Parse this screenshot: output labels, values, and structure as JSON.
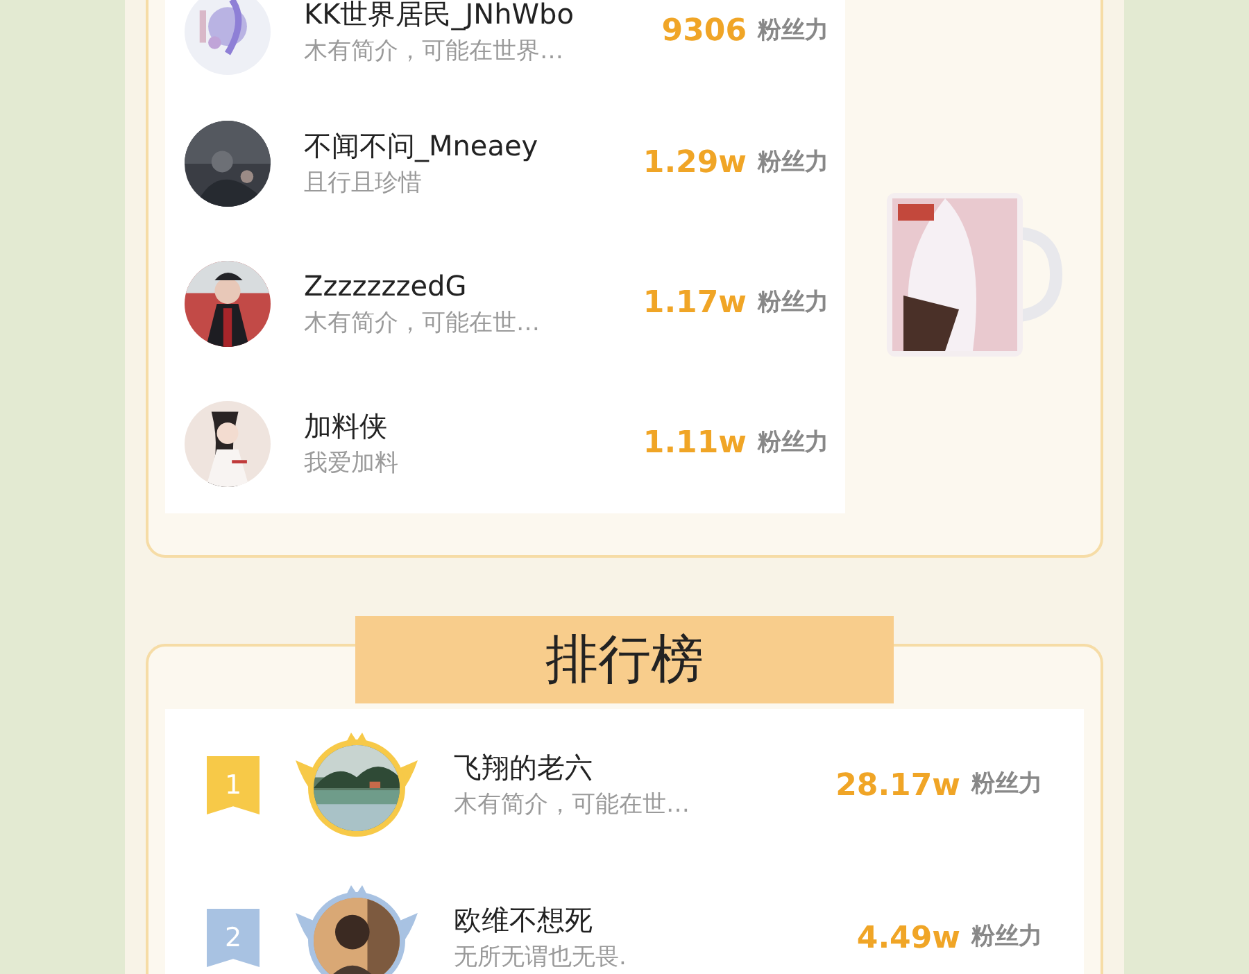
{
  "fans": [
    {
      "name": "KK世界居民_JNhWbo",
      "bio": "木有简介，可能在世界…",
      "count": "9306",
      "unit": "粉丝力"
    },
    {
      "name": "不闻不问_Mneaey",
      "bio": "且行且珍惜",
      "count": "1.29w",
      "unit": "粉丝力"
    },
    {
      "name": "ZzzzzzzedG",
      "bio": "木有简介，可能在世…",
      "count": "1.17w",
      "unit": "粉丝力"
    },
    {
      "name": "加料侠",
      "bio": "我爱加料",
      "count": "1.11w",
      "unit": "粉丝力"
    }
  ],
  "ranking": {
    "title": "排行榜",
    "rows": [
      {
        "rank": "1",
        "color": "#f7c948",
        "name": "飞翔的老六",
        "bio": "木有简介，可能在世…",
        "count": "28.17w",
        "unit": "粉丝力"
      },
      {
        "rank": "2",
        "color": "#a8c2e2",
        "name": "欧维不想死",
        "bio": "无所无谓也无畏.",
        "count": "4.49w",
        "unit": "粉丝力"
      }
    ]
  }
}
